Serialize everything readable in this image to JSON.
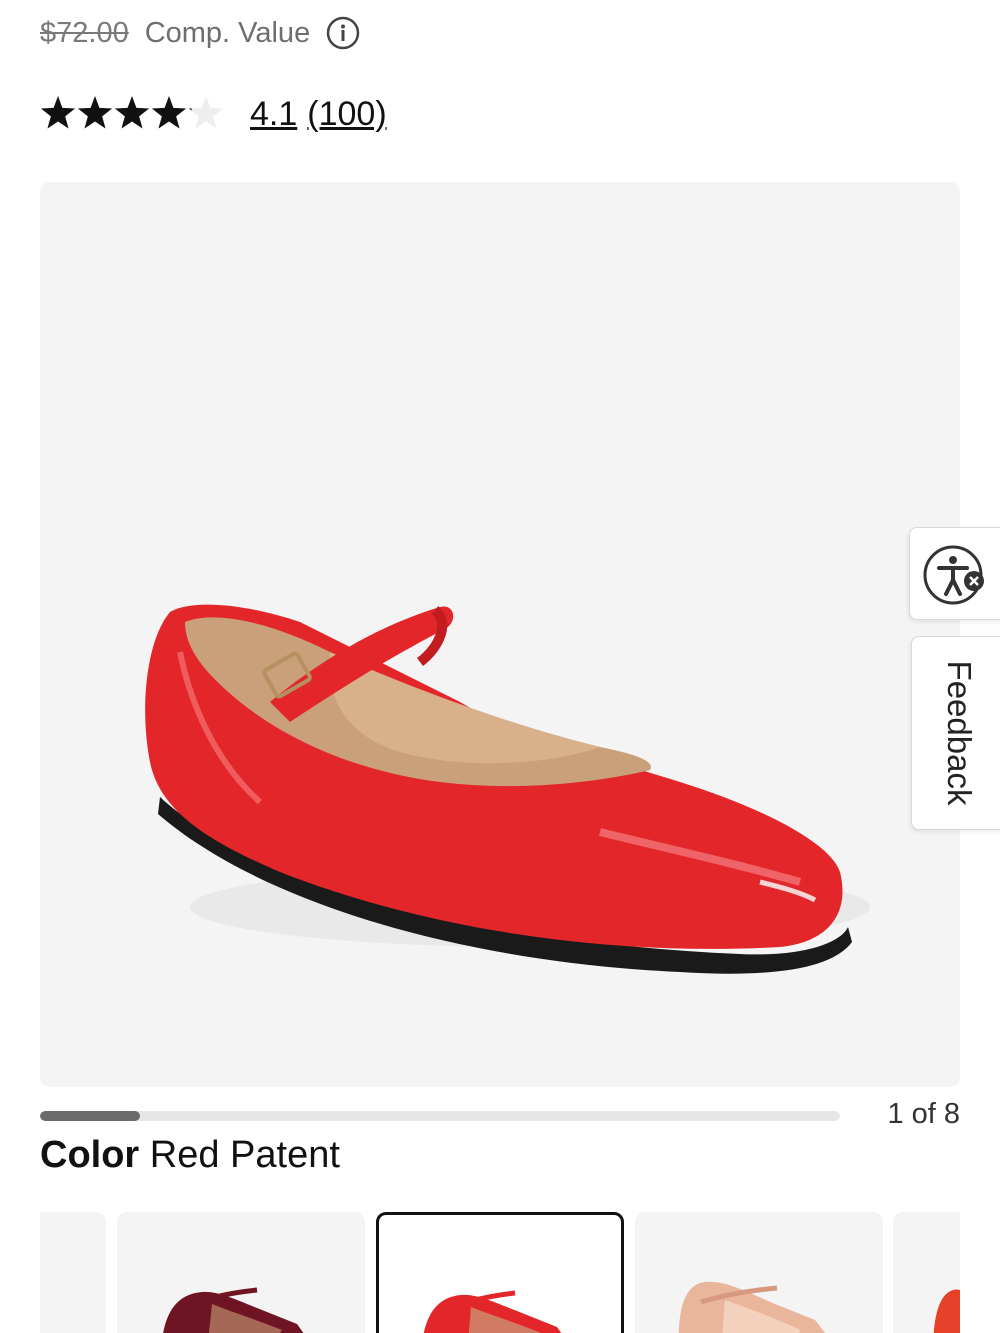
{
  "price": {
    "comp_value": "$72.00",
    "comp_label": "Comp. Value",
    "info_icon": "info-circle-icon"
  },
  "rating": {
    "value": "4.1",
    "count": "(100)",
    "stars_out_of_5": 4.1
  },
  "gallery": {
    "current": 1,
    "total": 8,
    "counter_text": "1 of 8",
    "progress_fraction": 0.125
  },
  "side_tabs": {
    "accessibility_icon": "accessibility-icon",
    "feedback_label": "Feedback"
  },
  "color": {
    "label": "Color",
    "selected_value": "Red Patent"
  },
  "swatches": [
    {
      "name": "burgundy",
      "color": "#6e1422",
      "selected": false
    },
    {
      "name": "red-patent",
      "color": "#e0282b",
      "selected": true
    },
    {
      "name": "nude",
      "color": "#e9b59b",
      "selected": false
    },
    {
      "name": "orange",
      "color": "#e8412a",
      "selected": false
    }
  ],
  "colors": {
    "star": "#111111",
    "star_empty": "#eeeeee",
    "shoe_red": "#e3262a",
    "shoe_lining": "#c9a07a"
  }
}
